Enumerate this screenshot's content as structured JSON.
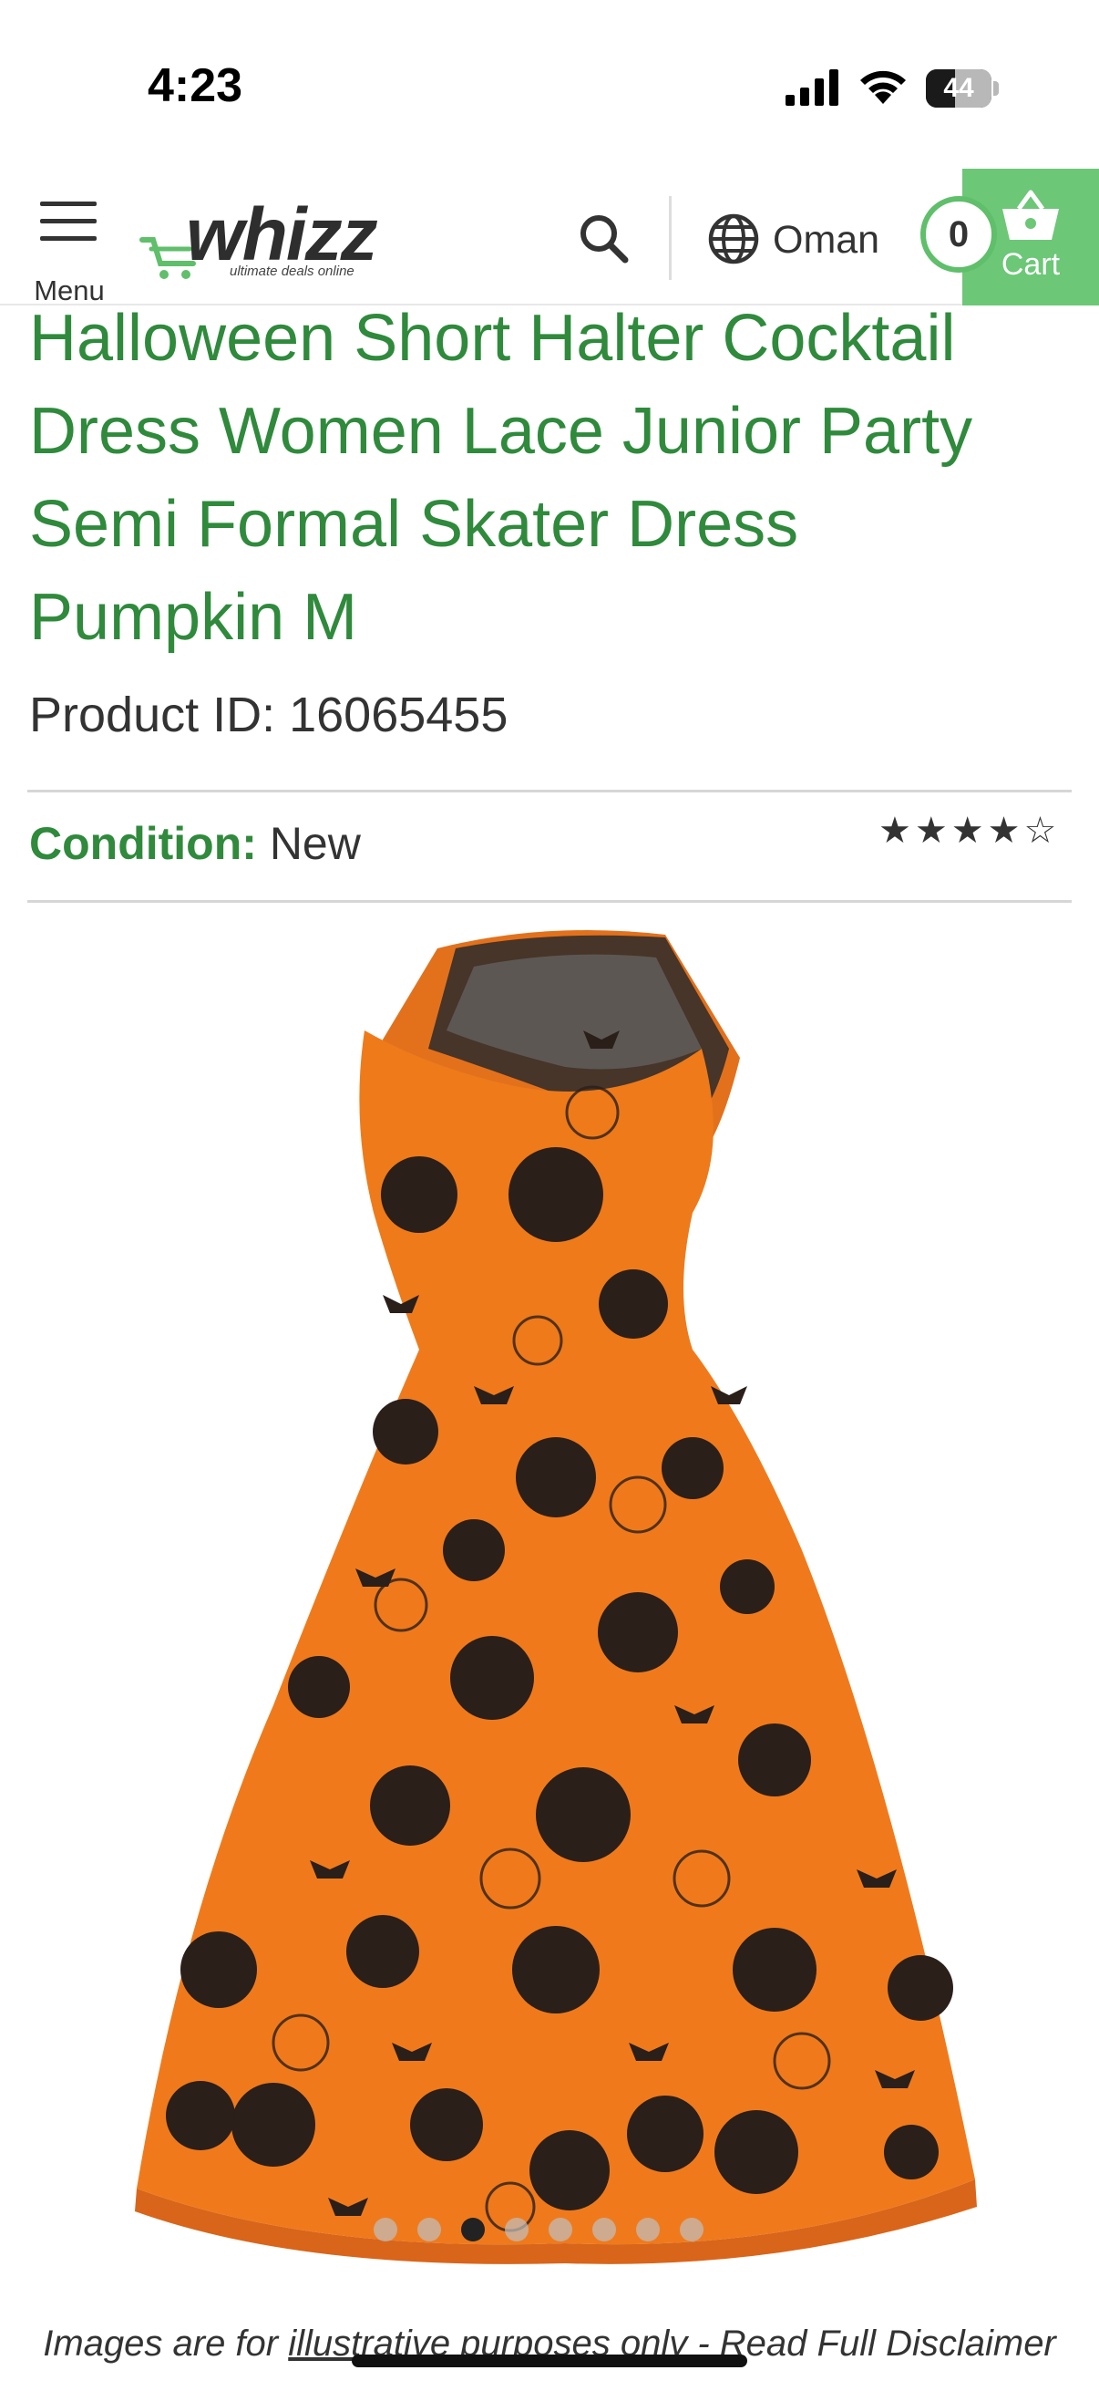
{
  "status_bar": {
    "time": "4:23",
    "battery": "44",
    "battery_level": 0.44
  },
  "header": {
    "menu_label": "Menu",
    "logo_text": "whizz",
    "logo_tagline": "ultimate deals online",
    "country": "Oman",
    "cart_count": "0",
    "cart_label": "Cart",
    "accent_color": "#6cc777"
  },
  "product": {
    "title": "Halloween Short Halter Cocktail Dress Women Lace Junior Party Semi Formal Skater Dress Pumpkin M",
    "product_id_label": "Product ID: ",
    "product_id": "16065455",
    "condition_label": "Condition:",
    "condition_value": "New",
    "rating": 4,
    "rating_max": 5,
    "title_color": "#2f8a3c"
  },
  "carousel": {
    "total": 8,
    "active_index": 2
  },
  "disclaimer": {
    "text_before": "Images are for ",
    "link_text": "illustrative purposes ",
    "text_after": "only - Read Full Disclaimer"
  }
}
